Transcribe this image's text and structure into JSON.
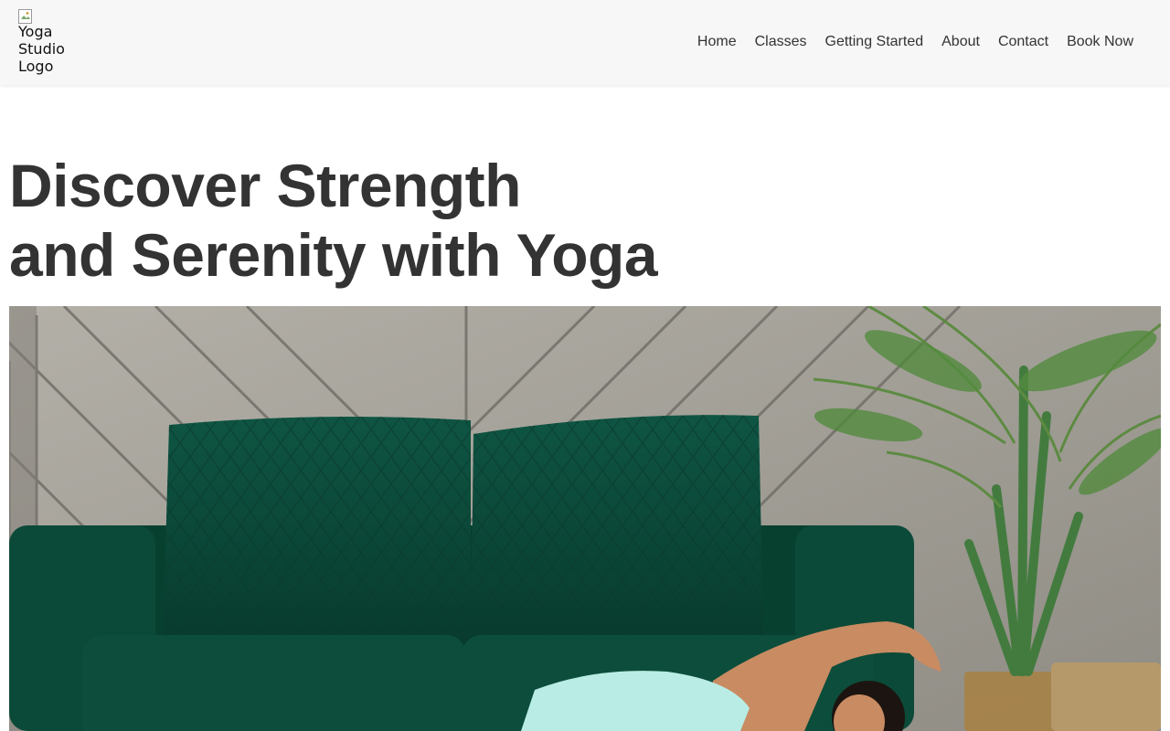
{
  "header": {
    "logo_alt": "Yoga\nStudio\nLogo",
    "nav": [
      {
        "label": "Home"
      },
      {
        "label": "Classes"
      },
      {
        "label": "Getting Started"
      },
      {
        "label": "About"
      },
      {
        "label": "Contact"
      },
      {
        "label": "Book Now"
      }
    ]
  },
  "hero": {
    "title_line1": "Discover Strength",
    "title_line2": "and Serenity with Yoga",
    "image_subject": "woman-doing-yoga-by-green-sofa"
  },
  "colors": {
    "header_bg": "#f7f7f7",
    "text": "#333333",
    "sofa_green": "#0d4a3a",
    "wall": "#a8a59e"
  }
}
